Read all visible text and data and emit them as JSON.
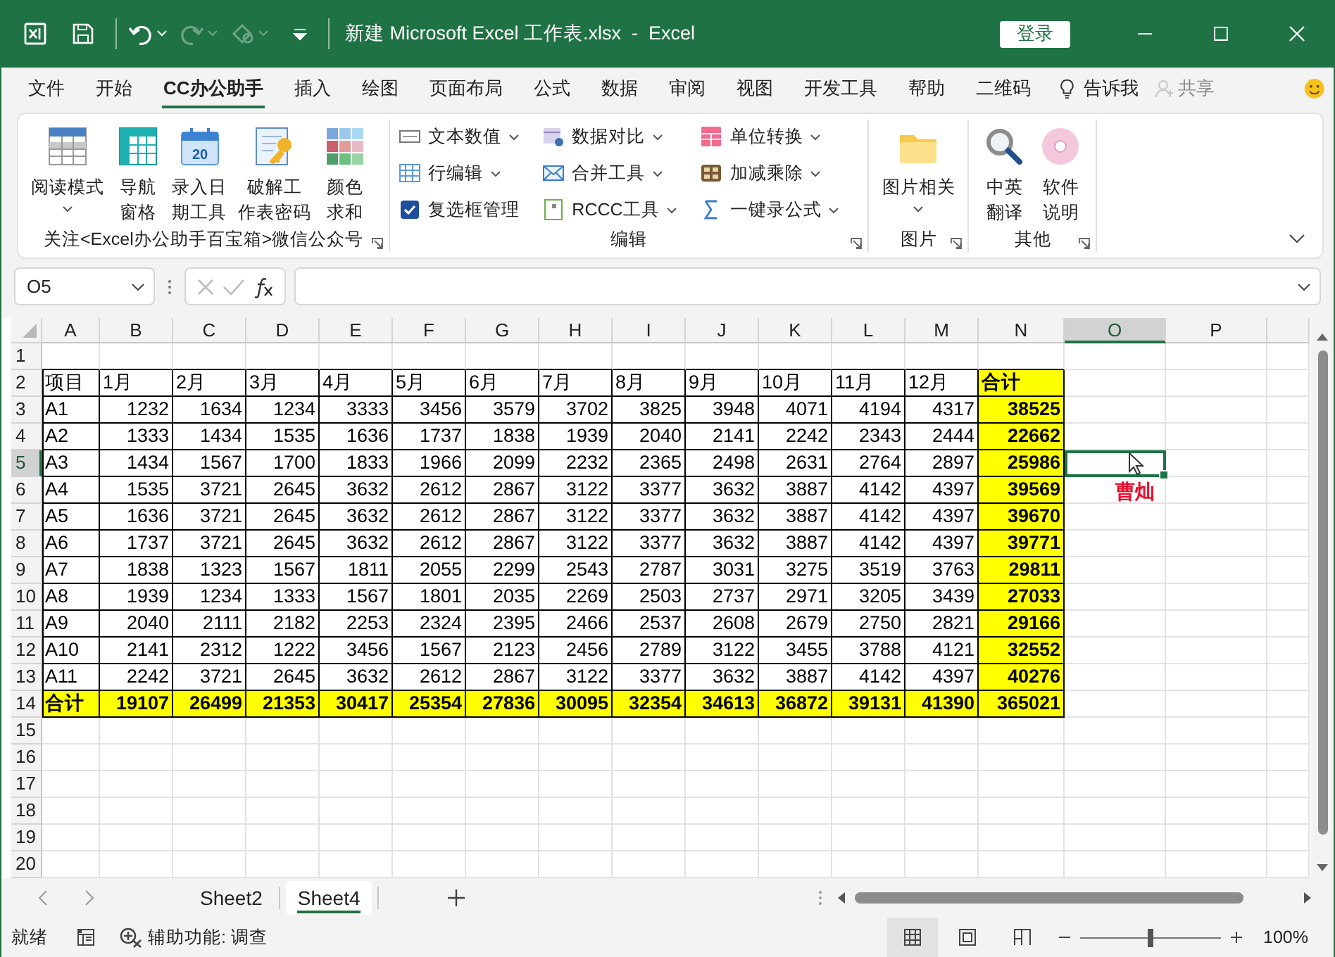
{
  "title_bar": {
    "title": "新建 Microsoft Excel 工作表.xlsx  -  Excel",
    "login_button": "登录"
  },
  "menu_tabs": [
    {
      "label": "文件",
      "selected": false
    },
    {
      "label": "开始",
      "selected": false
    },
    {
      "label": "CC办公助手",
      "selected": true
    },
    {
      "label": "插入",
      "selected": false
    },
    {
      "label": "绘图",
      "selected": false
    },
    {
      "label": "页面布局",
      "selected": false
    },
    {
      "label": "公式",
      "selected": false
    },
    {
      "label": "数据",
      "selected": false
    },
    {
      "label": "审阅",
      "selected": false
    },
    {
      "label": "视图",
      "selected": false
    },
    {
      "label": "开发工具",
      "selected": false
    },
    {
      "label": "帮助",
      "selected": false
    },
    {
      "label": "二维码",
      "selected": false
    }
  ],
  "tell_me": "告诉我",
  "share": "共享",
  "ribbon_groups": [
    {
      "kind": "large",
      "label": "关注<Excel办公助手百宝箱>微信公众号",
      "launcher": true,
      "buttons": [
        {
          "lines": [
            "阅读模式"
          ],
          "menu": true
        },
        {
          "lines": [
            "导航",
            "窗格"
          ],
          "menu": false
        },
        {
          "lines": [
            "录入日",
            "期工具"
          ],
          "icon_text": "20",
          "menu": false
        },
        {
          "lines": [
            "破解工",
            "作表密码"
          ],
          "menu": false
        },
        {
          "lines": [
            "颜色",
            "求和"
          ],
          "menu": false
        }
      ]
    },
    {
      "kind": "small",
      "label": "编辑",
      "launcher": true,
      "columns": [
        [
          {
            "label": "文本数值",
            "menu": true
          },
          {
            "label": "行编辑",
            "menu": true
          },
          {
            "label": "复选框管理",
            "menu": false
          }
        ],
        [
          {
            "label": "数据对比",
            "menu": true
          },
          {
            "label": "合并工具",
            "menu": true
          },
          {
            "label": "RCCC工具",
            "menu": true
          }
        ],
        [
          {
            "label": "单位转换",
            "menu": true
          },
          {
            "label": "加减乘除",
            "menu": true
          },
          {
            "label": "一键录公式",
            "menu": true
          }
        ]
      ]
    },
    {
      "kind": "large",
      "label": "图片",
      "launcher": true,
      "buttons": [
        {
          "lines": [
            "图片相关"
          ],
          "menu": true
        }
      ]
    },
    {
      "kind": "large",
      "label": "其他",
      "launcher": true,
      "buttons": [
        {
          "lines": [
            "中英",
            "翻译"
          ],
          "menu": false
        },
        {
          "lines": [
            "软件",
            "说明"
          ],
          "menu": false
        }
      ]
    }
  ],
  "formula_bar": {
    "name_box": "O5"
  },
  "grid": {
    "columns": [
      {
        "letter": "A",
        "selected": false
      },
      {
        "letter": "B",
        "selected": false
      },
      {
        "letter": "C",
        "selected": false
      },
      {
        "letter": "D",
        "selected": false
      },
      {
        "letter": "E",
        "selected": false
      },
      {
        "letter": "F",
        "selected": false
      },
      {
        "letter": "G",
        "selected": false
      },
      {
        "letter": "H",
        "selected": false
      },
      {
        "letter": "I",
        "selected": false
      },
      {
        "letter": "J",
        "selected": false
      },
      {
        "letter": "K",
        "selected": false
      },
      {
        "letter": "L",
        "selected": false
      },
      {
        "letter": "M",
        "selected": false
      },
      {
        "letter": "N",
        "selected": false
      },
      {
        "letter": "O",
        "selected": true
      },
      {
        "letter": "P",
        "selected": false
      }
    ],
    "rows": [
      {
        "number": "1",
        "selected": false
      },
      {
        "number": "2",
        "selected": false,
        "kind": "header",
        "cells": [
          "项目",
          "1月",
          "2月",
          "3月",
          "4月",
          "5月",
          "6月",
          "7月",
          "8月",
          "9月",
          "10月",
          "11月",
          "12月",
          "合计"
        ]
      },
      {
        "number": "3",
        "selected": false,
        "kind": "data",
        "cells": [
          "A1",
          "1232",
          "1634",
          "1234",
          "3333",
          "3456",
          "3579",
          "3702",
          "3825",
          "3948",
          "4071",
          "4194",
          "4317",
          "38525"
        ]
      },
      {
        "number": "4",
        "selected": false,
        "kind": "data",
        "cells": [
          "A2",
          "1333",
          "1434",
          "1535",
          "1636",
          "1737",
          "1838",
          "1939",
          "2040",
          "2141",
          "2242",
          "2343",
          "2444",
          "22662"
        ]
      },
      {
        "number": "5",
        "selected": true,
        "kind": "data",
        "cells": [
          "A3",
          "1434",
          "1567",
          "1700",
          "1833",
          "1966",
          "2099",
          "2232",
          "2365",
          "2498",
          "2631",
          "2764",
          "2897",
          "25986"
        ]
      },
      {
        "number": "6",
        "selected": false,
        "kind": "data",
        "cells": [
          "A4",
          "1535",
          "3721",
          "2645",
          "3632",
          "2612",
          "2867",
          "3122",
          "3377",
          "3632",
          "3887",
          "4142",
          "4397",
          "39569"
        ],
        "extra_cells": [
          {
            "text": "曹灿",
            "color": "#e8102e"
          }
        ]
      },
      {
        "number": "7",
        "selected": false,
        "kind": "data",
        "cells": [
          "A5",
          "1636",
          "3721",
          "2645",
          "3632",
          "2612",
          "2867",
          "3122",
          "3377",
          "3632",
          "3887",
          "4142",
          "4397",
          "39670"
        ]
      },
      {
        "number": "8",
        "selected": false,
        "kind": "data",
        "cells": [
          "A6",
          "1737",
          "3721",
          "2645",
          "3632",
          "2612",
          "2867",
          "3122",
          "3377",
          "3632",
          "3887",
          "4142",
          "4397",
          "39771"
        ]
      },
      {
        "number": "9",
        "selected": false,
        "kind": "data",
        "cells": [
          "A7",
          "1838",
          "1323",
          "1567",
          "1811",
          "2055",
          "2299",
          "2543",
          "2787",
          "3031",
          "3275",
          "3519",
          "3763",
          "29811"
        ]
      },
      {
        "number": "10",
        "selected": false,
        "kind": "data",
        "cells": [
          "A8",
          "1939",
          "1234",
          "1333",
          "1567",
          "1801",
          "2035",
          "2269",
          "2503",
          "2737",
          "2971",
          "3205",
          "3439",
          "27033"
        ]
      },
      {
        "number": "11",
        "selected": false,
        "kind": "data",
        "cells": [
          "A9",
          "2040",
          "2111",
          "2182",
          "2253",
          "2324",
          "2395",
          "2466",
          "2537",
          "2608",
          "2679",
          "2750",
          "2821",
          "29166"
        ]
      },
      {
        "number": "12",
        "selected": false,
        "kind": "data",
        "cells": [
          "A10",
          "2141",
          "2312",
          "1222",
          "3456",
          "1567",
          "2123",
          "2456",
          "2789",
          "3122",
          "3455",
          "3788",
          "4121",
          "32552"
        ]
      },
      {
        "number": "13",
        "selected": false,
        "kind": "data",
        "cells": [
          "A11",
          "2242",
          "3721",
          "2645",
          "3632",
          "2612",
          "2867",
          "3122",
          "3377",
          "3632",
          "3887",
          "4142",
          "4397",
          "40276"
        ]
      },
      {
        "number": "14",
        "selected": false,
        "kind": "total",
        "cells": [
          "合计",
          "19107",
          "26499",
          "21353",
          "30417",
          "25354",
          "27836",
          "30095",
          "32354",
          "34613",
          "36872",
          "39131",
          "41390",
          "365021"
        ]
      },
      {
        "number": "15",
        "selected": false
      },
      {
        "number": "16",
        "selected": false
      },
      {
        "number": "17",
        "selected": false
      },
      {
        "number": "18",
        "selected": false
      },
      {
        "number": "19",
        "selected": false
      },
      {
        "number": "20",
        "selected": false
      }
    ]
  },
  "sheet_tabs": [
    {
      "label": "Sheet2",
      "selected": false
    },
    {
      "label": "Sheet4",
      "selected": true
    }
  ],
  "status_bar": {
    "status": "就绪",
    "accessibility": "辅助功能: 调查",
    "views": [
      {
        "kind": "normal",
        "selected": true
      },
      {
        "kind": "page_layout",
        "selected": false
      },
      {
        "kind": "page_break",
        "selected": false
      }
    ],
    "zoom": {
      "level": 0.5,
      "reading": "100%"
    }
  }
}
